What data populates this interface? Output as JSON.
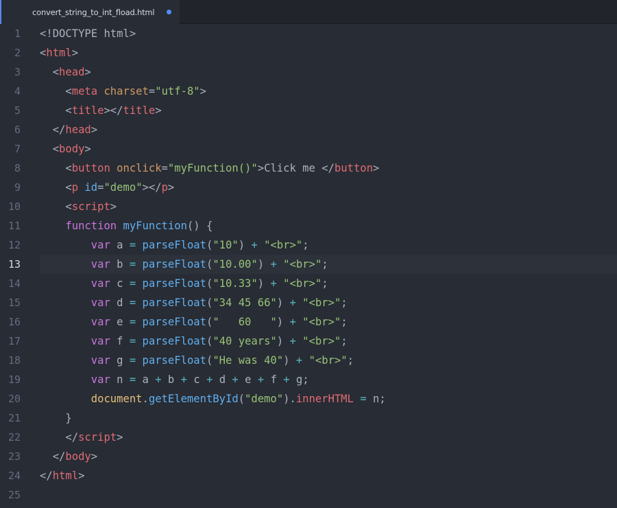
{
  "tab": {
    "title": "convert_string_to_int_fload.html",
    "modified": true
  },
  "editor": {
    "active_line": 13,
    "lines": [
      {
        "n": "1",
        "t": [
          [
            "plain",
            "<!DOCTYPE html>"
          ]
        ]
      },
      {
        "n": "2",
        "t": [
          [
            "plain",
            "<"
          ],
          [
            "tag",
            "html"
          ],
          [
            "plain",
            ">"
          ]
        ]
      },
      {
        "n": "3",
        "t": [
          [
            "plain",
            "  <"
          ],
          [
            "tag",
            "head"
          ],
          [
            "plain",
            ">"
          ]
        ]
      },
      {
        "n": "4",
        "t": [
          [
            "plain",
            "    <"
          ],
          [
            "tag",
            "meta"
          ],
          [
            "plain",
            " "
          ],
          [
            "attr",
            "charset"
          ],
          [
            "plain",
            "="
          ],
          [
            "str",
            "\"utf-8\""
          ],
          [
            "plain",
            ">"
          ]
        ]
      },
      {
        "n": "5",
        "t": [
          [
            "plain",
            "    <"
          ],
          [
            "tag",
            "title"
          ],
          [
            "plain",
            "></"
          ],
          [
            "tag",
            "title"
          ],
          [
            "plain",
            ">"
          ]
        ]
      },
      {
        "n": "6",
        "t": [
          [
            "plain",
            "  </"
          ],
          [
            "tag",
            "head"
          ],
          [
            "plain",
            ">"
          ]
        ]
      },
      {
        "n": "7",
        "t": [
          [
            "plain",
            "  <"
          ],
          [
            "tag",
            "body"
          ],
          [
            "plain",
            ">"
          ]
        ]
      },
      {
        "n": "8",
        "t": [
          [
            "plain",
            "    <"
          ],
          [
            "tag",
            "button"
          ],
          [
            "plain",
            " "
          ],
          [
            "attr",
            "onclick"
          ],
          [
            "plain",
            "="
          ],
          [
            "str",
            "\"myFunction()\""
          ],
          [
            "plain",
            ">Click me </"
          ],
          [
            "tag",
            "button"
          ],
          [
            "plain",
            ">"
          ]
        ]
      },
      {
        "n": "9",
        "t": [
          [
            "plain",
            "    <"
          ],
          [
            "tag",
            "p"
          ],
          [
            "plain",
            " "
          ],
          [
            "id",
            "id"
          ],
          [
            "plain",
            "="
          ],
          [
            "str",
            "\"demo\""
          ],
          [
            "plain",
            "></"
          ],
          [
            "tag",
            "p"
          ],
          [
            "plain",
            ">"
          ]
        ]
      },
      {
        "n": "10",
        "t": [
          [
            "plain",
            "    <"
          ],
          [
            "tag",
            "script"
          ],
          [
            "plain",
            ">"
          ]
        ]
      },
      {
        "n": "11",
        "t": [
          [
            "plain",
            "    "
          ],
          [
            "kw",
            "function"
          ],
          [
            "plain",
            " "
          ],
          [
            "fn",
            "myFunction"
          ],
          [
            "plain",
            "() {"
          ]
        ]
      },
      {
        "n": "12",
        "t": [
          [
            "plain",
            "        "
          ],
          [
            "kw",
            "var"
          ],
          [
            "plain",
            " a "
          ],
          [
            "op",
            "="
          ],
          [
            "plain",
            " "
          ],
          [
            "fn",
            "parseFloat"
          ],
          [
            "plain",
            "("
          ],
          [
            "str",
            "\"10\""
          ],
          [
            "plain",
            ") "
          ],
          [
            "op",
            "+"
          ],
          [
            "plain",
            " "
          ],
          [
            "str",
            "\"<br>\""
          ],
          [
            "plain",
            ";"
          ]
        ]
      },
      {
        "n": "13",
        "t": [
          [
            "plain",
            "        "
          ],
          [
            "kw",
            "var"
          ],
          [
            "plain",
            " b "
          ],
          [
            "op",
            "="
          ],
          [
            "plain",
            " "
          ],
          [
            "fn",
            "parseFloat"
          ],
          [
            "plain",
            "("
          ],
          [
            "str",
            "\"10.00\""
          ],
          [
            "plain",
            ") "
          ],
          [
            "op",
            "+"
          ],
          [
            "plain",
            " "
          ],
          [
            "str",
            "\"<br>\""
          ],
          [
            "plain",
            ";"
          ]
        ]
      },
      {
        "n": "14",
        "t": [
          [
            "plain",
            "        "
          ],
          [
            "kw",
            "var"
          ],
          [
            "plain",
            " c "
          ],
          [
            "op",
            "="
          ],
          [
            "plain",
            " "
          ],
          [
            "fn",
            "parseFloat"
          ],
          [
            "plain",
            "("
          ],
          [
            "str",
            "\"10.33\""
          ],
          [
            "plain",
            ") "
          ],
          [
            "op",
            "+"
          ],
          [
            "plain",
            " "
          ],
          [
            "str",
            "\"<br>\""
          ],
          [
            "plain",
            ";"
          ]
        ]
      },
      {
        "n": "15",
        "t": [
          [
            "plain",
            "        "
          ],
          [
            "kw",
            "var"
          ],
          [
            "plain",
            " d "
          ],
          [
            "op",
            "="
          ],
          [
            "plain",
            " "
          ],
          [
            "fn",
            "parseFloat"
          ],
          [
            "plain",
            "("
          ],
          [
            "str",
            "\"34 45 66\""
          ],
          [
            "plain",
            ") "
          ],
          [
            "op",
            "+"
          ],
          [
            "plain",
            " "
          ],
          [
            "str",
            "\"<br>\""
          ],
          [
            "plain",
            ";"
          ]
        ]
      },
      {
        "n": "16",
        "t": [
          [
            "plain",
            "        "
          ],
          [
            "kw",
            "var"
          ],
          [
            "plain",
            " e "
          ],
          [
            "op",
            "="
          ],
          [
            "plain",
            " "
          ],
          [
            "fn",
            "parseFloat"
          ],
          [
            "plain",
            "("
          ],
          [
            "str",
            "\"   60   \""
          ],
          [
            "plain",
            ") "
          ],
          [
            "op",
            "+"
          ],
          [
            "plain",
            " "
          ],
          [
            "str",
            "\"<br>\""
          ],
          [
            "plain",
            ";"
          ]
        ]
      },
      {
        "n": "17",
        "t": [
          [
            "plain",
            "        "
          ],
          [
            "kw",
            "var"
          ],
          [
            "plain",
            " f "
          ],
          [
            "op",
            "="
          ],
          [
            "plain",
            " "
          ],
          [
            "fn",
            "parseFloat"
          ],
          [
            "plain",
            "("
          ],
          [
            "str",
            "\"40 years\""
          ],
          [
            "plain",
            ") "
          ],
          [
            "op",
            "+"
          ],
          [
            "plain",
            " "
          ],
          [
            "str",
            "\"<br>\""
          ],
          [
            "plain",
            ";"
          ]
        ]
      },
      {
        "n": "18",
        "t": [
          [
            "plain",
            "        "
          ],
          [
            "kw",
            "var"
          ],
          [
            "plain",
            " g "
          ],
          [
            "op",
            "="
          ],
          [
            "plain",
            " "
          ],
          [
            "fn",
            "parseFloat"
          ],
          [
            "plain",
            "("
          ],
          [
            "str",
            "\"He was 40\""
          ],
          [
            "plain",
            ") "
          ],
          [
            "op",
            "+"
          ],
          [
            "plain",
            " "
          ],
          [
            "str",
            "\"<br>\""
          ],
          [
            "plain",
            ";"
          ]
        ]
      },
      {
        "n": "19",
        "t": [
          [
            "plain",
            "        "
          ],
          [
            "kw",
            "var"
          ],
          [
            "plain",
            " n "
          ],
          [
            "op",
            "="
          ],
          [
            "plain",
            " a "
          ],
          [
            "op",
            "+"
          ],
          [
            "plain",
            " b "
          ],
          [
            "op",
            "+"
          ],
          [
            "plain",
            " c "
          ],
          [
            "op",
            "+"
          ],
          [
            "plain",
            " d "
          ],
          [
            "op",
            "+"
          ],
          [
            "plain",
            " e "
          ],
          [
            "op",
            "+"
          ],
          [
            "plain",
            " f "
          ],
          [
            "op",
            "+"
          ],
          [
            "plain",
            " g;"
          ]
        ]
      },
      {
        "n": "20",
        "t": [
          [
            "plain",
            "        "
          ],
          [
            "var",
            "document"
          ],
          [
            "plain",
            "."
          ],
          [
            "fn",
            "getElementById"
          ],
          [
            "plain",
            "("
          ],
          [
            "str",
            "\"demo\""
          ],
          [
            "plain",
            ")."
          ],
          [
            "prop",
            "innerHTML"
          ],
          [
            "plain",
            " "
          ],
          [
            "op",
            "="
          ],
          [
            "plain",
            " n;"
          ]
        ]
      },
      {
        "n": "21",
        "t": [
          [
            "plain",
            "    }"
          ]
        ]
      },
      {
        "n": "22",
        "t": [
          [
            "plain",
            "    </"
          ],
          [
            "tag",
            "script"
          ],
          [
            "plain",
            ">"
          ]
        ]
      },
      {
        "n": "23",
        "t": [
          [
            "plain",
            "  </"
          ],
          [
            "tag",
            "body"
          ],
          [
            "plain",
            ">"
          ]
        ]
      },
      {
        "n": "24",
        "t": [
          [
            "plain",
            "</"
          ],
          [
            "tag",
            "html"
          ],
          [
            "plain",
            ">"
          ]
        ]
      },
      {
        "n": "25",
        "t": []
      }
    ]
  }
}
